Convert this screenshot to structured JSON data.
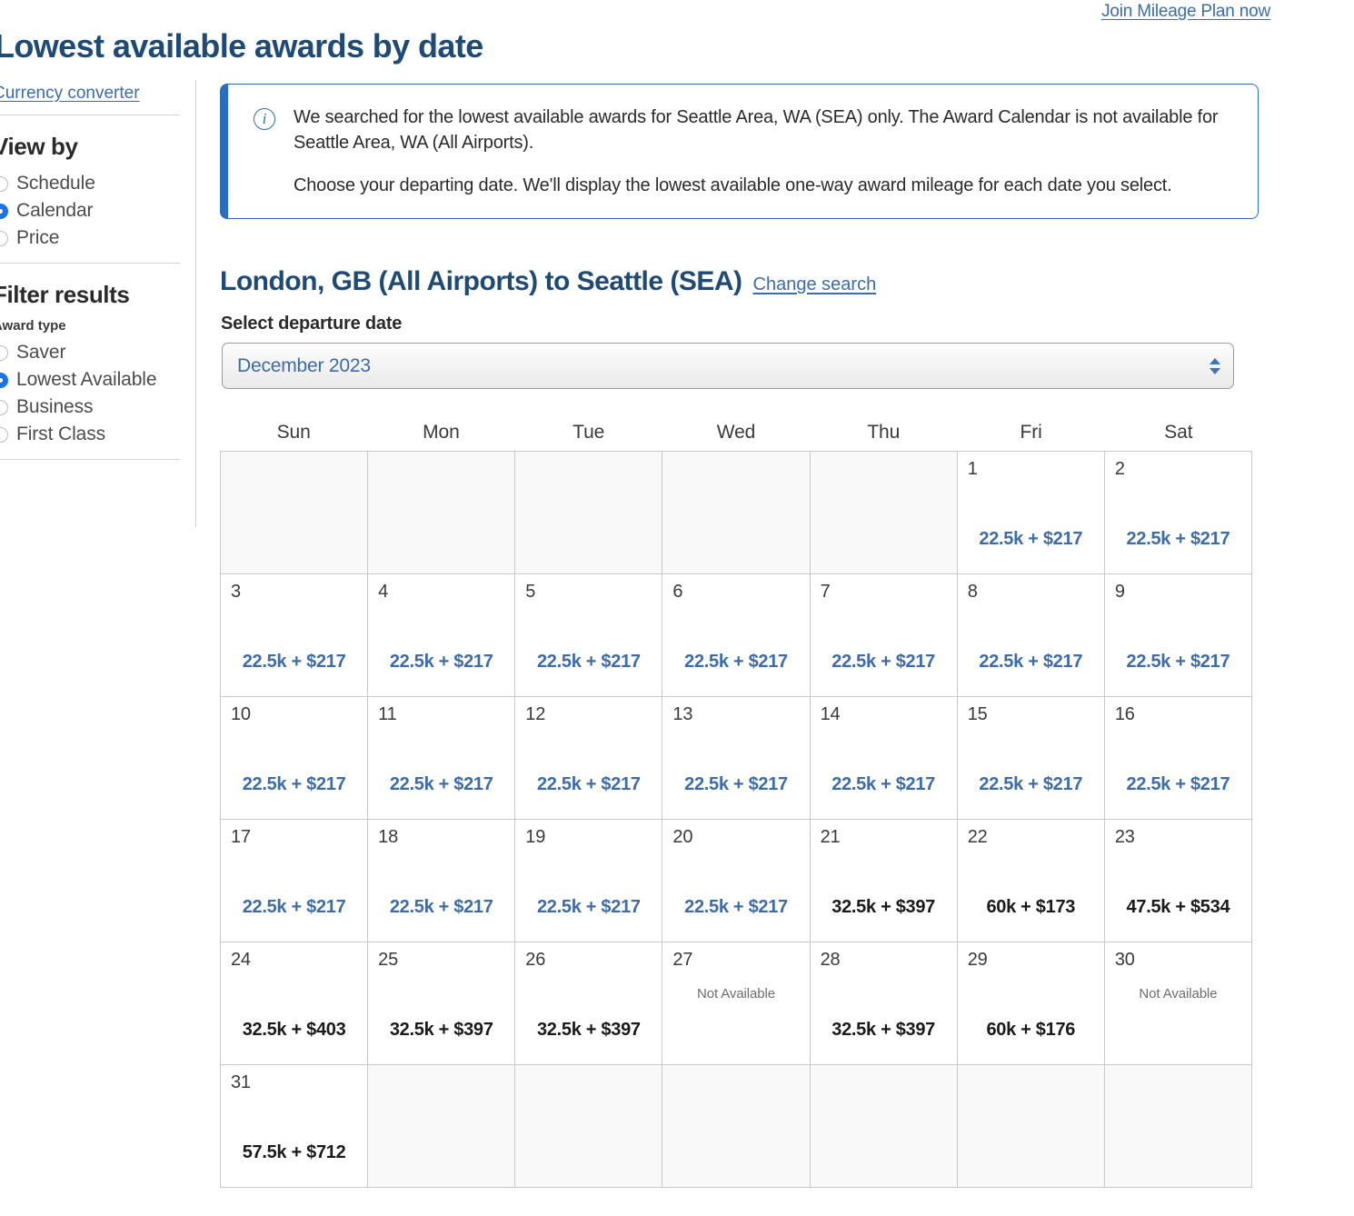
{
  "header": {
    "title": "Lowest available awards by date",
    "join_link": "Join Mileage Plan now"
  },
  "sidebar": {
    "currency_converter": "Currency converter",
    "view_by": {
      "heading": "View by",
      "options": [
        {
          "label": "Schedule",
          "selected": false
        },
        {
          "label": "Calendar",
          "selected": true
        },
        {
          "label": "Price",
          "selected": false
        }
      ]
    },
    "filter_results": {
      "heading": "Filter results",
      "award_type_label": "Award type",
      "options": [
        {
          "label": "Saver",
          "selected": false
        },
        {
          "label": "Lowest Available",
          "selected": true
        },
        {
          "label": "Business",
          "selected": false
        },
        {
          "label": "First Class",
          "selected": false
        }
      ]
    }
  },
  "info_box": {
    "icon": "info-circle-icon",
    "paragraphs": [
      "We searched for the lowest available awards for Seattle Area, WA (SEA) only. The Award Calendar is not available for Seattle Area, WA (All Airports).",
      "Choose your departing date. We'll display the lowest available one-way award mileage for each date you select."
    ]
  },
  "route": {
    "title": "London, GB (All Airports) to Seattle (SEA)",
    "change_search": "Change search"
  },
  "departure": {
    "label": "Select departure date",
    "selected_month": "December 2023"
  },
  "calendar": {
    "weekdays": [
      "Sun",
      "Mon",
      "Tue",
      "Wed",
      "Thu",
      "Fri",
      "Sat"
    ],
    "not_available_text": "Not Available",
    "lowest_color": "#3d6ca8",
    "normal_color": "#1a1a1a",
    "weeks": [
      [
        {
          "day": "",
          "price": "",
          "kind": "empty"
        },
        {
          "day": "",
          "price": "",
          "kind": "empty"
        },
        {
          "day": "",
          "price": "",
          "kind": "empty"
        },
        {
          "day": "",
          "price": "",
          "kind": "empty"
        },
        {
          "day": "",
          "price": "",
          "kind": "empty"
        },
        {
          "day": "1",
          "price": "22.5k + $217",
          "kind": "lowest"
        },
        {
          "day": "2",
          "price": "22.5k + $217",
          "kind": "lowest"
        }
      ],
      [
        {
          "day": "3",
          "price": "22.5k + $217",
          "kind": "lowest"
        },
        {
          "day": "4",
          "price": "22.5k + $217",
          "kind": "lowest"
        },
        {
          "day": "5",
          "price": "22.5k + $217",
          "kind": "lowest"
        },
        {
          "day": "6",
          "price": "22.5k + $217",
          "kind": "lowest"
        },
        {
          "day": "7",
          "price": "22.5k + $217",
          "kind": "lowest"
        },
        {
          "day": "8",
          "price": "22.5k + $217",
          "kind": "lowest"
        },
        {
          "day": "9",
          "price": "22.5k + $217",
          "kind": "lowest"
        }
      ],
      [
        {
          "day": "10",
          "price": "22.5k + $217",
          "kind": "lowest"
        },
        {
          "day": "11",
          "price": "22.5k + $217",
          "kind": "lowest"
        },
        {
          "day": "12",
          "price": "22.5k + $217",
          "kind": "lowest"
        },
        {
          "day": "13",
          "price": "22.5k + $217",
          "kind": "lowest"
        },
        {
          "day": "14",
          "price": "22.5k + $217",
          "kind": "lowest"
        },
        {
          "day": "15",
          "price": "22.5k + $217",
          "kind": "lowest"
        },
        {
          "day": "16",
          "price": "22.5k + $217",
          "kind": "lowest"
        }
      ],
      [
        {
          "day": "17",
          "price": "22.5k + $217",
          "kind": "lowest"
        },
        {
          "day": "18",
          "price": "22.5k + $217",
          "kind": "lowest"
        },
        {
          "day": "19",
          "price": "22.5k + $217",
          "kind": "lowest"
        },
        {
          "day": "20",
          "price": "22.5k + $217",
          "kind": "lowest"
        },
        {
          "day": "21",
          "price": "32.5k + $397",
          "kind": "normal"
        },
        {
          "day": "22",
          "price": "60k + $173",
          "kind": "normal"
        },
        {
          "day": "23",
          "price": "47.5k + $534",
          "kind": "normal"
        }
      ],
      [
        {
          "day": "24",
          "price": "32.5k + $403",
          "kind": "normal"
        },
        {
          "day": "25",
          "price": "32.5k + $397",
          "kind": "normal"
        },
        {
          "day": "26",
          "price": "32.5k + $397",
          "kind": "normal"
        },
        {
          "day": "27",
          "price": "",
          "kind": "unavailable"
        },
        {
          "day": "28",
          "price": "32.5k + $397",
          "kind": "normal"
        },
        {
          "day": "29",
          "price": "60k + $176",
          "kind": "normal"
        },
        {
          "day": "30",
          "price": "",
          "kind": "unavailable"
        }
      ],
      [
        {
          "day": "31",
          "price": "57.5k + $712",
          "kind": "normal"
        },
        {
          "day": "",
          "price": "",
          "kind": "empty"
        },
        {
          "day": "",
          "price": "",
          "kind": "empty"
        },
        {
          "day": "",
          "price": "",
          "kind": "empty"
        },
        {
          "day": "",
          "price": "",
          "kind": "empty"
        },
        {
          "day": "",
          "price": "",
          "kind": "empty"
        },
        {
          "day": "",
          "price": "",
          "kind": "empty"
        }
      ]
    ]
  }
}
